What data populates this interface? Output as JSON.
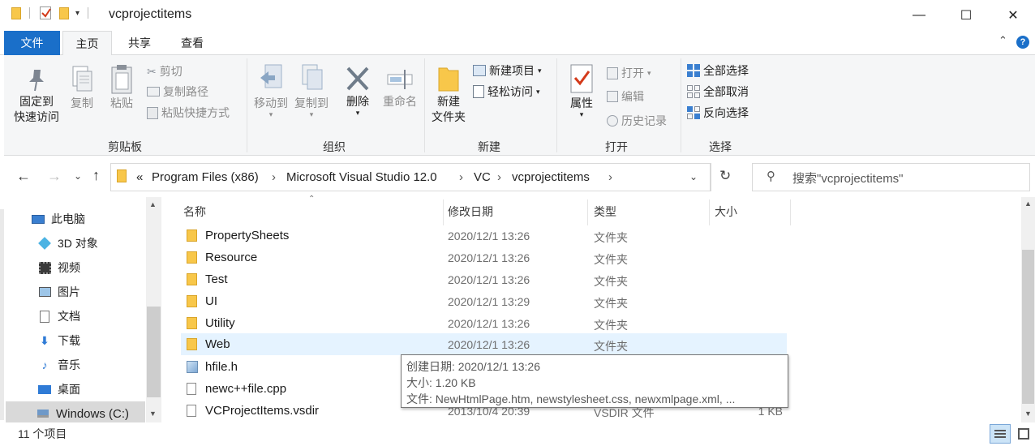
{
  "window": {
    "title": "vcprojectitems",
    "minimize": "—",
    "maximize": "☐",
    "close": "✕"
  },
  "ribbon_tabs": [
    "文件",
    "主页",
    "共享",
    "查看"
  ],
  "ribbon": {
    "clipboard": {
      "label": "剪贴板",
      "pin_line1": "固定到",
      "pin_line2": "快速访问",
      "copy": "复制",
      "paste": "粘贴",
      "cut": "剪切",
      "copy_path": "复制路径",
      "paste_shortcut": "粘贴快捷方式"
    },
    "organize": {
      "label": "组织",
      "move_to": "移动到",
      "copy_to": "复制到",
      "delete": "删除",
      "rename": "重命名"
    },
    "new": {
      "label": "新建",
      "new_folder_line1": "新建",
      "new_folder_line2": "文件夹",
      "new_item": "新建项目",
      "easy_access": "轻松访问"
    },
    "open": {
      "label": "打开",
      "properties": "属性",
      "open": "打开",
      "edit": "编辑",
      "history": "历史记录"
    },
    "select": {
      "label": "选择",
      "select_all": "全部选择",
      "select_none": "全部取消",
      "invert": "反向选择"
    }
  },
  "address": {
    "overflow": "«",
    "crumbs": [
      "Program Files (x86)",
      "Microsoft Visual Studio 12.0",
      "VC",
      "vcprojectitems"
    ],
    "sep": "›",
    "search_placeholder": "搜索\"vcprojectitems\""
  },
  "nav": {
    "items": [
      {
        "label": "此电脑",
        "icon": "computer-icon"
      },
      {
        "label": "3D 对象",
        "icon": "3d-objects-icon"
      },
      {
        "label": "视频",
        "icon": "video-icon"
      },
      {
        "label": "图片",
        "icon": "pictures-icon"
      },
      {
        "label": "文档",
        "icon": "documents-icon"
      },
      {
        "label": "下载",
        "icon": "download-icon"
      },
      {
        "label": "音乐",
        "icon": "music-icon"
      },
      {
        "label": "桌面",
        "icon": "desktop-icon"
      },
      {
        "label": "Windows (C:)",
        "icon": "drive-icon"
      }
    ]
  },
  "columns": [
    "名称",
    "修改日期",
    "类型",
    "大小"
  ],
  "files": [
    {
      "name": "PropertySheets",
      "date": "2020/12/1 13:26",
      "type": "文件夹",
      "size": "",
      "icon": "folder-icon"
    },
    {
      "name": "Resource",
      "date": "2020/12/1 13:26",
      "type": "文件夹",
      "size": "",
      "icon": "folder-icon"
    },
    {
      "name": "Test",
      "date": "2020/12/1 13:26",
      "type": "文件夹",
      "size": "",
      "icon": "folder-icon"
    },
    {
      "name": "UI",
      "date": "2020/12/1 13:29",
      "type": "文件夹",
      "size": "",
      "icon": "folder-icon"
    },
    {
      "name": "Utility",
      "date": "2020/12/1 13:26",
      "type": "文件夹",
      "size": "",
      "icon": "folder-icon"
    },
    {
      "name": "Web",
      "date": "2020/12/1 13:26",
      "type": "文件夹",
      "size": "",
      "icon": "folder-icon"
    },
    {
      "name": "hfile.h",
      "date": "",
      "type": "",
      "size": "",
      "icon": "header-file-icon"
    },
    {
      "name": "newc++file.cpp",
      "date": "",
      "type": "",
      "size": "",
      "icon": "file-icon"
    },
    {
      "name": "VCProjectItems.vsdir",
      "date": "2013/10/4 20:39",
      "type": "VSDIR 文件",
      "size": "1 KB",
      "icon": "file-icon"
    }
  ],
  "tooltip": {
    "line1": "创建日期: 2020/12/1 13:26",
    "line2": "大小: 1.20 KB",
    "line3": "文件: NewHtmlPage.htm, newstylesheet.css, newxmlpage.xml, ..."
  },
  "status": {
    "count": "11 个项目"
  },
  "colors": {
    "file_tab": "#1a6fc9",
    "folder": "#f8c74a",
    "selection": "#e5f3ff"
  }
}
